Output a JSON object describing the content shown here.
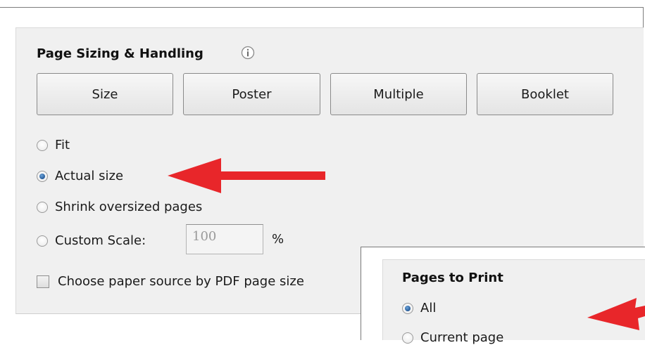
{
  "page_sizing": {
    "title": "Page Sizing & Handling",
    "buttons": [
      {
        "label": "Size"
      },
      {
        "label": "Poster"
      },
      {
        "label": "Multiple"
      },
      {
        "label": "Booklet"
      }
    ],
    "options": [
      {
        "label": "Fit",
        "checked": false
      },
      {
        "label": "Actual size",
        "checked": true
      },
      {
        "label": "Shrink oversized pages",
        "checked": false
      },
      {
        "label": "Custom Scale:",
        "checked": false
      }
    ],
    "custom_scale_value": "100",
    "percent_symbol": "%",
    "paper_source_label": "Choose paper source by PDF page size"
  },
  "pages_to_print": {
    "title": "Pages to Print",
    "options": [
      {
        "label": "All",
        "checked": true
      },
      {
        "label": "Current page",
        "checked": false
      }
    ]
  },
  "colors": {
    "arrow": "#e8262a",
    "panel_bg": "#f0f0f0",
    "radio_checked": "#1b4f8e"
  },
  "icons": {
    "info": "info-icon",
    "arrow": "red-arrow-annotation"
  }
}
